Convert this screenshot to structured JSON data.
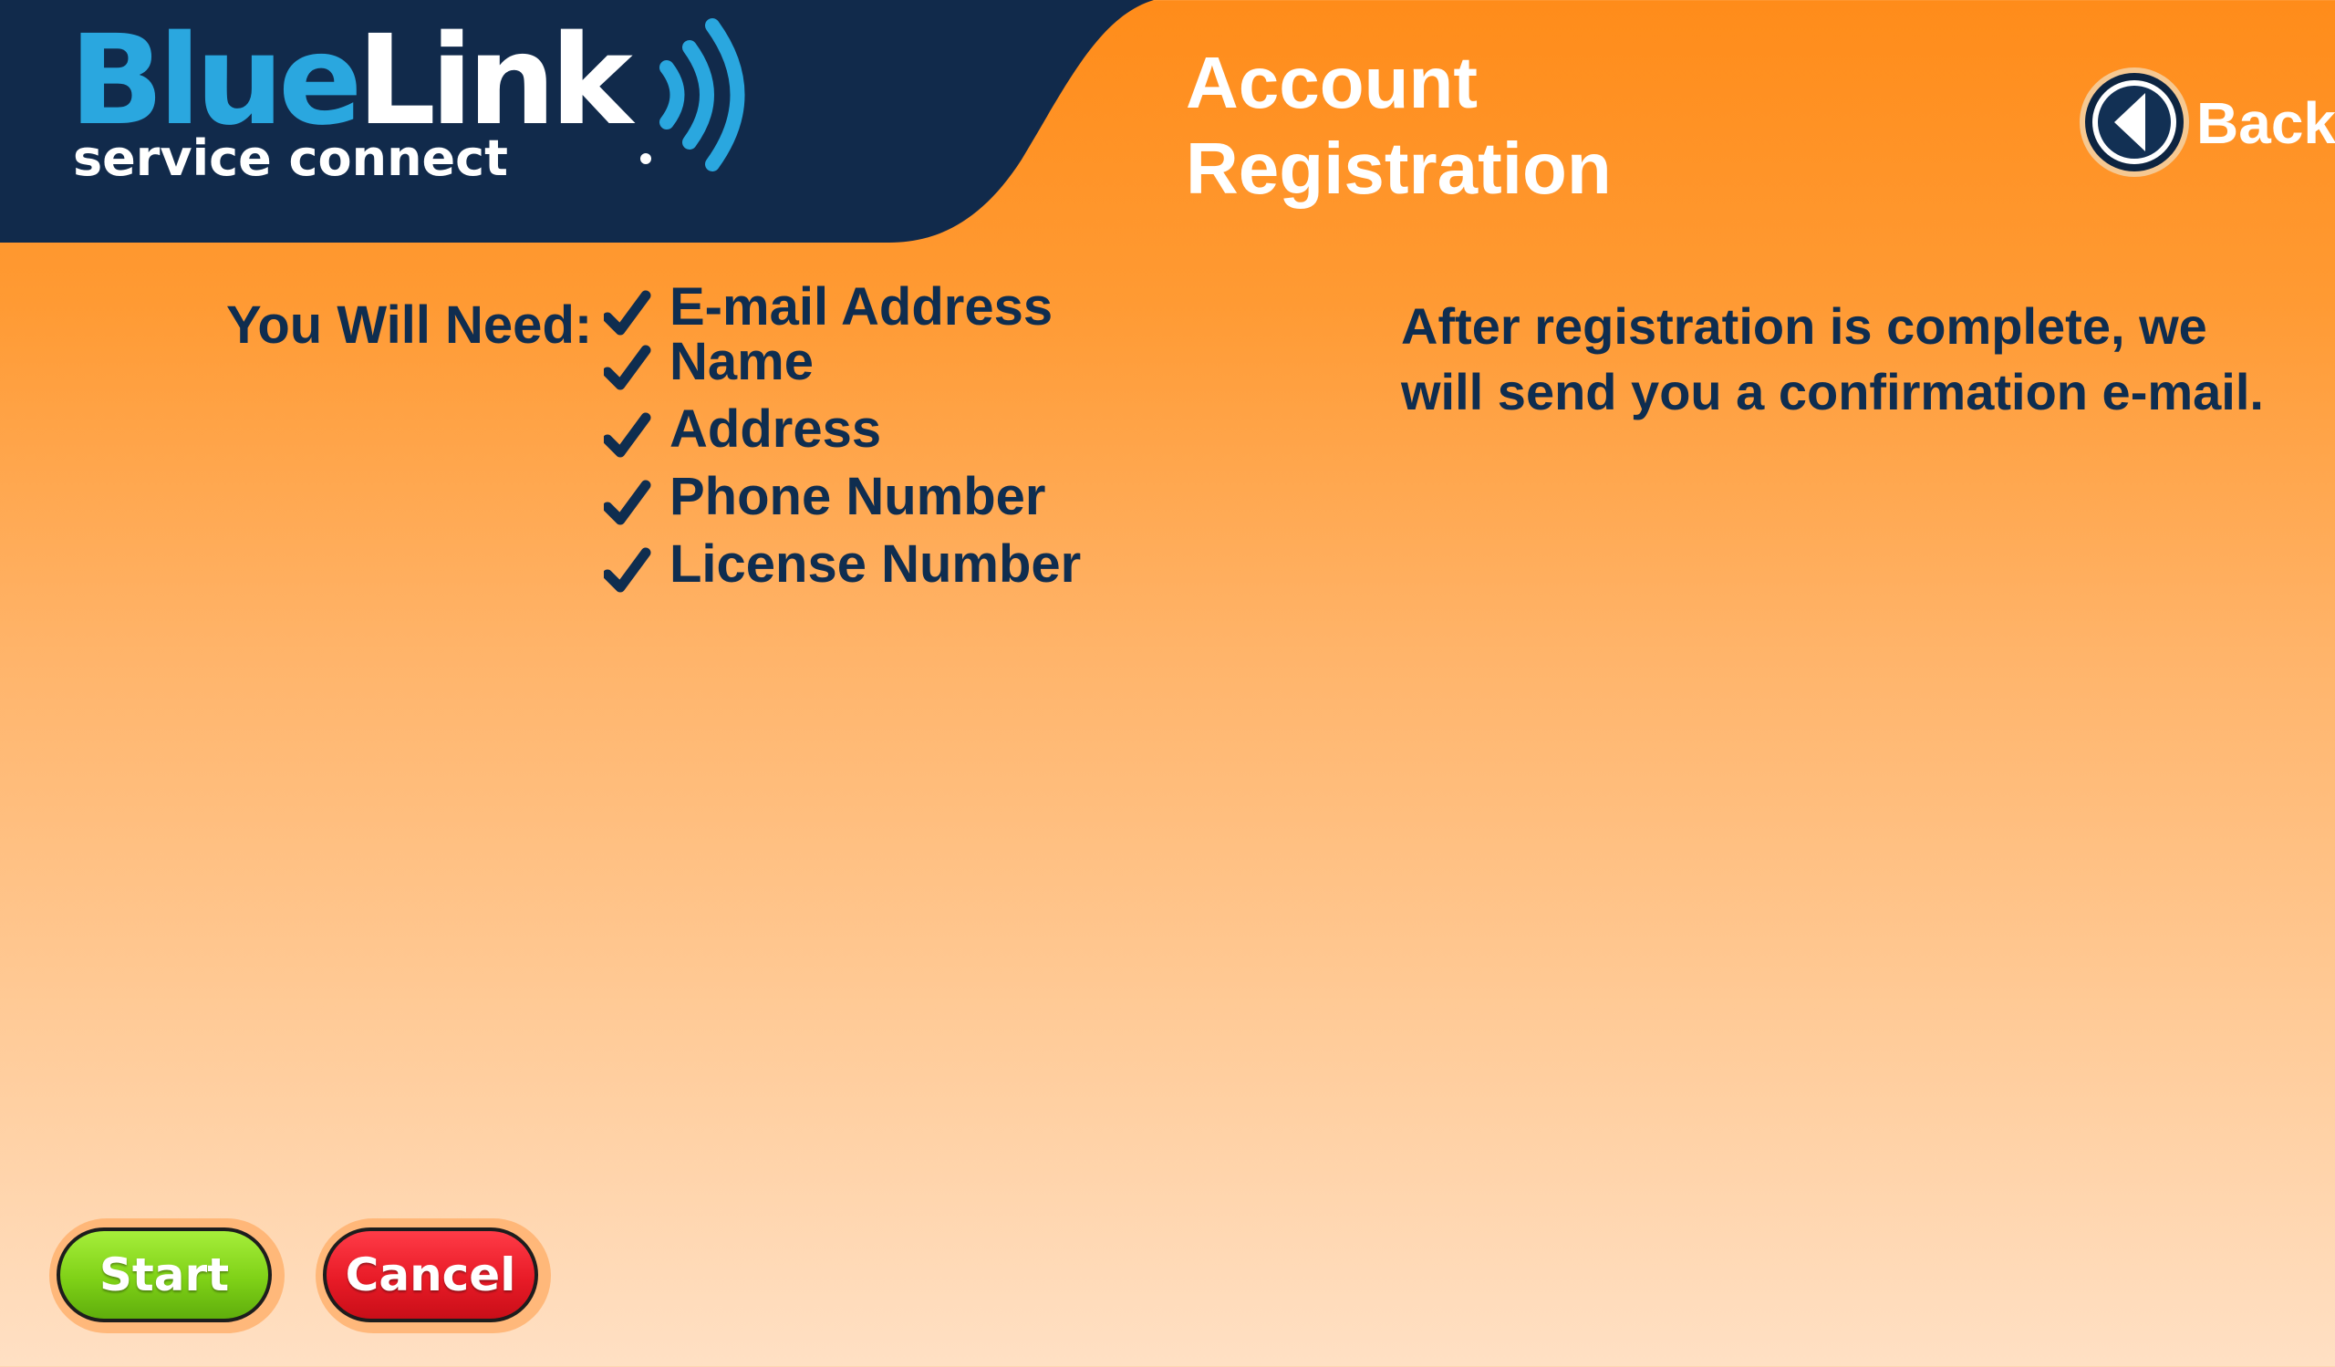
{
  "colors": {
    "header_navy": "#112a4b",
    "accent_orange": "#ff8c1a",
    "logo_blue": "#2aa7df",
    "text_navy": "#0f2d4f",
    "start_green": "#7fd117",
    "cancel_red": "#e81b27"
  },
  "logo": {
    "brand_blue": "Blue",
    "brand_white": "Link",
    "tagline": "service connect"
  },
  "header": {
    "title_line1": "Account",
    "title_line2": "Registration"
  },
  "back": {
    "label": "Back",
    "icon": "chevron-left-icon"
  },
  "requirements": {
    "label": "You Will Need:",
    "items": [
      {
        "label": "E-mail Address",
        "icon": "checkmark-icon"
      },
      {
        "label": "Name",
        "icon": "checkmark-icon"
      },
      {
        "label": "Address",
        "icon": "checkmark-icon"
      },
      {
        "label": "Phone Number",
        "icon": "checkmark-icon"
      },
      {
        "label": "License Number",
        "icon": "checkmark-icon"
      }
    ]
  },
  "info": {
    "line1": "After registration is complete, we",
    "line2": "will send you a confirmation e-mail."
  },
  "actions": {
    "start_label": "Start",
    "cancel_label": "Cancel"
  }
}
